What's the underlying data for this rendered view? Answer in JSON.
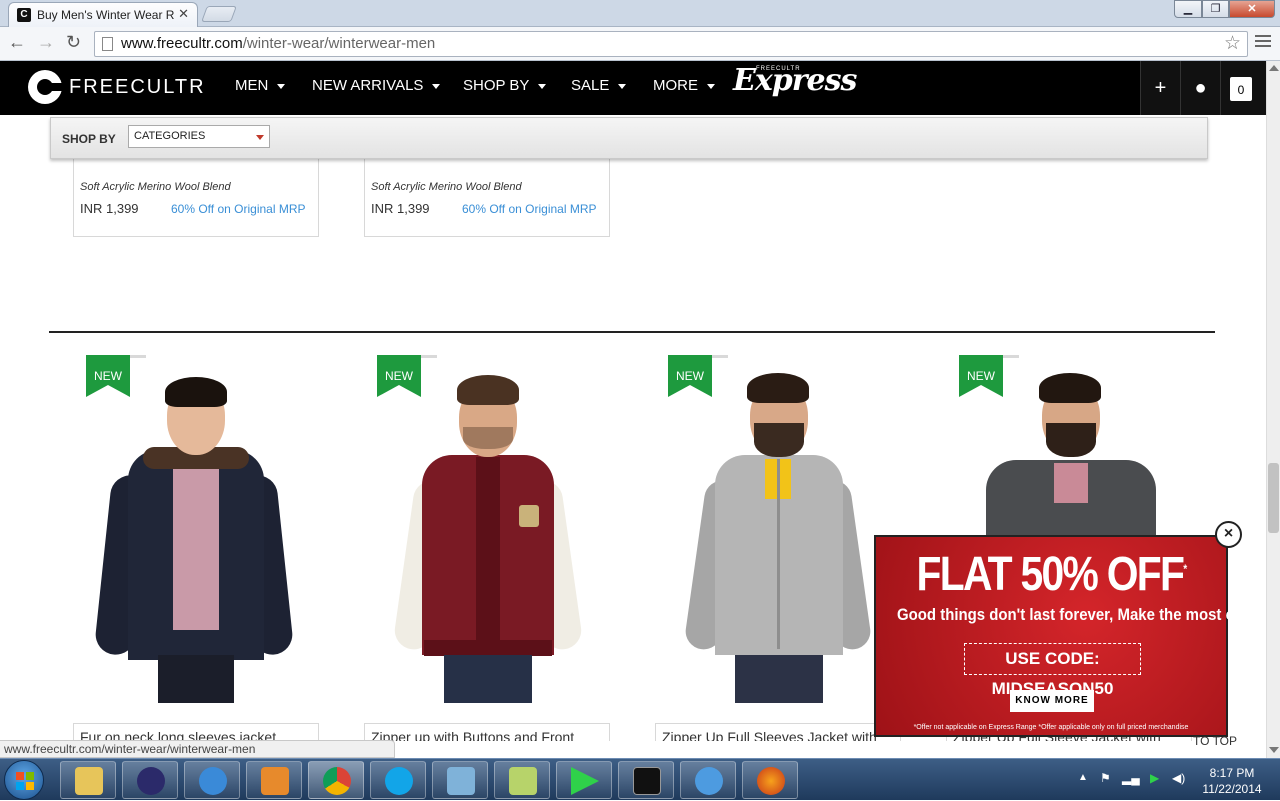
{
  "browser": {
    "tab_title": "Buy Men's Winter Wear Ra",
    "tab_favicon": "C",
    "tab_close": "✕",
    "url_domain": "www.freecultr.com",
    "url_path": "/winter-wear/winterwear-men",
    "status_url": "www.freecultr.com/winter-wear/winterwear-men"
  },
  "site": {
    "logo_text": "FREECULTR",
    "nav": [
      {
        "label": "MEN"
      },
      {
        "label": "NEW ARRIVALS"
      },
      {
        "label": "SHOP BY"
      },
      {
        "label": "SALE"
      },
      {
        "label": "MORE"
      }
    ],
    "express_tag": "FREECULTR",
    "express_label": "Express",
    "cart_count": "0"
  },
  "shopby": {
    "label": "SHOP BY",
    "select_value": "CATEGORIES"
  },
  "previous_row": [
    {
      "desc": "Soft Acrylic Merino Wool Blend",
      "price": "INR  1,399",
      "discount": "60% Off on Original MRP"
    },
    {
      "desc": "Soft Acrylic Merino Wool Blend",
      "price": "INR  1,399",
      "discount": "60% Off on Original MRP"
    }
  ],
  "products": [
    {
      "badge": "NEW",
      "name": "Fur on neck long sleeves jacket"
    },
    {
      "badge": "NEW",
      "name": "Zipper up with Buttons and Front Rounded Pockets Contrast Color"
    },
    {
      "badge": "NEW",
      "name": "Zipper Up Full Sleeves Jacket with Logo, Square Pockets and Coin"
    },
    {
      "badge": "NEW",
      "name": "Zipper Up Full Sleeve Jacket with Pockets in Front"
    }
  ],
  "promo": {
    "headline": "FLAT 50% OFF",
    "headline_mark": "*",
    "subline": "Good things don't last forever, Make the most of it now!",
    "code": "USE CODE: MIDSEASON50",
    "cta": "KNOW MORE",
    "fine_print": "*Offer not applicable on Express Range *Offer applicable only on full priced merchandise",
    "close": "×"
  },
  "to_top": "TO TOP",
  "taskbar": {
    "time": "8:17 PM",
    "date": "11/22/2014"
  }
}
